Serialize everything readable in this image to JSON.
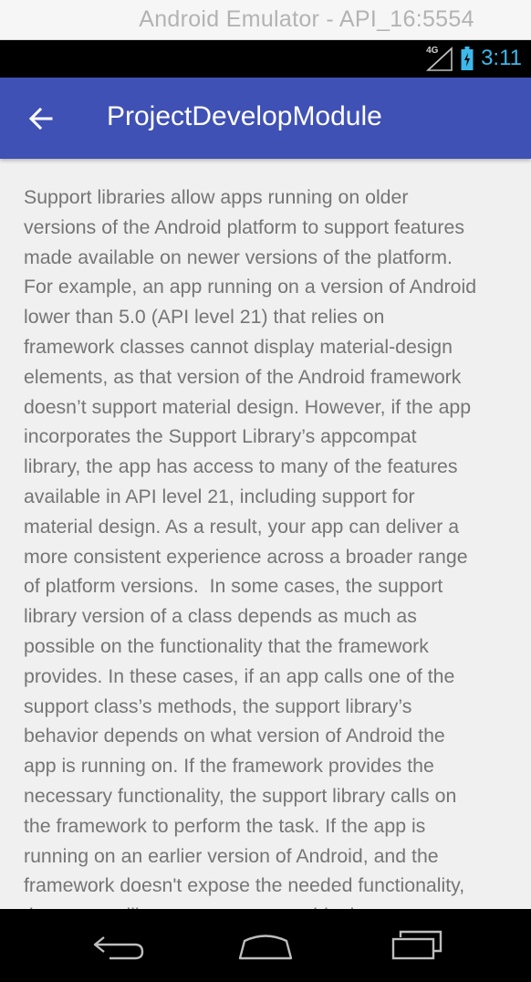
{
  "emulator": {
    "title": "Android Emulator - API_16:5554"
  },
  "status_bar": {
    "network_type": "4G",
    "icons": [
      "signal-icon",
      "battery-icon"
    ],
    "time": "3:11",
    "clock_color": "#3db8ea"
  },
  "toolbar": {
    "back_icon": "arrow-back-icon",
    "title": "ProjectDevelopModule",
    "color": "#3f51b5"
  },
  "content": {
    "text": "Support libraries allow apps running on older\nversions of the Android platform to support features\nmade available on newer versions of the platform.\nFor example, an app running on a version of Android\nlower than 5.0 (API level 21) that relies on\nframework classes cannot display material-design\nelements, as that version of the Android framework\ndoesn’t support material design. However, if the app\nincorporates the Support Library’s appcompat\nlibrary, the app has access to many of the features\navailable in API level 21, including support for\nmaterial design. As a result, your app can deliver a\nmore consistent experience across a broader range\nof platform versions.  In some cases, the support\nlibrary version of a class depends as much as\npossible on the functionality that the framework\nprovides. In these cases, if an app calls one of the\nsupport class’s methods, the support library’s\nbehavior depends on what version of Android the\napp is running on. If the framework provides the\nnecessary functionality, the support library calls on\nthe framework to perform the task. If the app is\nrunning on an earlier version of Android, and the\nframework doesn't expose the needed functionality,\nthe support library may try to provide the"
  },
  "nav_bar": {
    "buttons": [
      "back-nav-icon",
      "home-nav-icon",
      "recents-nav-icon"
    ]
  }
}
